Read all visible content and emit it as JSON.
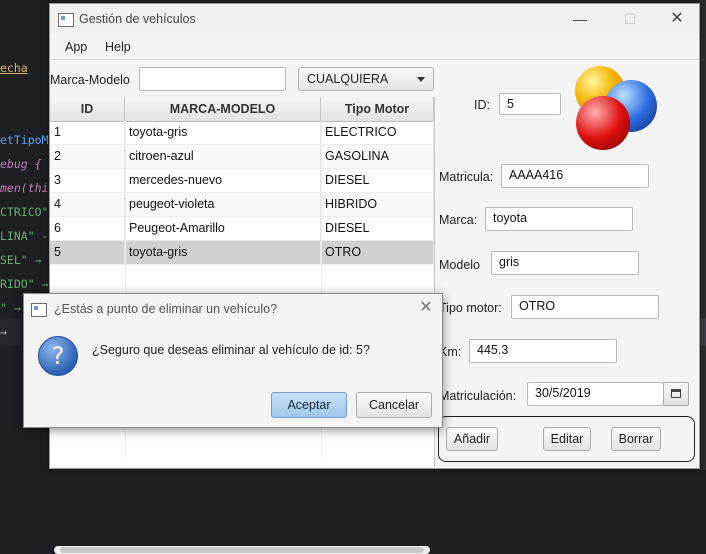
{
  "background_code": {
    "lines": [
      "echa",
      "etTipoMo",
      "ebug { ",
      "men(this",
      "CTRICO\"",
      "LINA\" -",
      "SEL\" →",
      "RIDO\" →",
      "\" →",
      "→"
    ]
  },
  "window": {
    "title": "Gestión de vehículos",
    "menu": [
      "App",
      "Help"
    ]
  },
  "filter": {
    "label": "Marca-Modelo",
    "input_value": "",
    "combo_value": "CUALQUIERA"
  },
  "table": {
    "columns": [
      "ID",
      "MARCA-MODELO",
      "Tipo Motor"
    ],
    "rows": [
      {
        "id": "1",
        "marca_modelo": "toyota-gris",
        "tipo": "ELECTRICO"
      },
      {
        "id": "2",
        "marca_modelo": "citroen-azul",
        "tipo": "GASOLINA"
      },
      {
        "id": "3",
        "marca_modelo": "mercedes-nuevo",
        "tipo": "DIESEL"
      },
      {
        "id": "4",
        "marca_modelo": "peugeot-violeta",
        "tipo": "HIBRIDO"
      },
      {
        "id": "6",
        "marca_modelo": "Peugeot-Amarillo",
        "tipo": "DIESEL"
      },
      {
        "id": "5",
        "marca_modelo": "toyota-gris",
        "tipo": "OTRO"
      }
    ],
    "selected_index": 5
  },
  "form": {
    "id_label": "ID:",
    "id_value": "5",
    "matricula_label": "Matricula:",
    "matricula_value": "AAAA416",
    "marca_label": "Marca:",
    "marca_value": "toyota",
    "modelo_label": "Modelo",
    "modelo_value": "gris",
    "motor_label": "Tipo motor:",
    "motor_value": "OTRO",
    "km_label": "Km:",
    "km_value": "445.3",
    "matriculacion_label": "Matriculación:",
    "matriculacion_value": "30/5/2019"
  },
  "buttons": {
    "add": "Añadir",
    "edit": "Editar",
    "delete": "Borrar"
  },
  "dialog": {
    "title": "¿Estás a punto de eliminar un vehículo?",
    "message": "¿Seguro que deseas eliminar al vehículo de id: 5?",
    "accept": "Aceptar",
    "cancel": "Cancelar",
    "icon_glyph": "?"
  },
  "colors": {
    "accept_button": "#a9cdf0",
    "selected_row": "#d0d0d0"
  }
}
